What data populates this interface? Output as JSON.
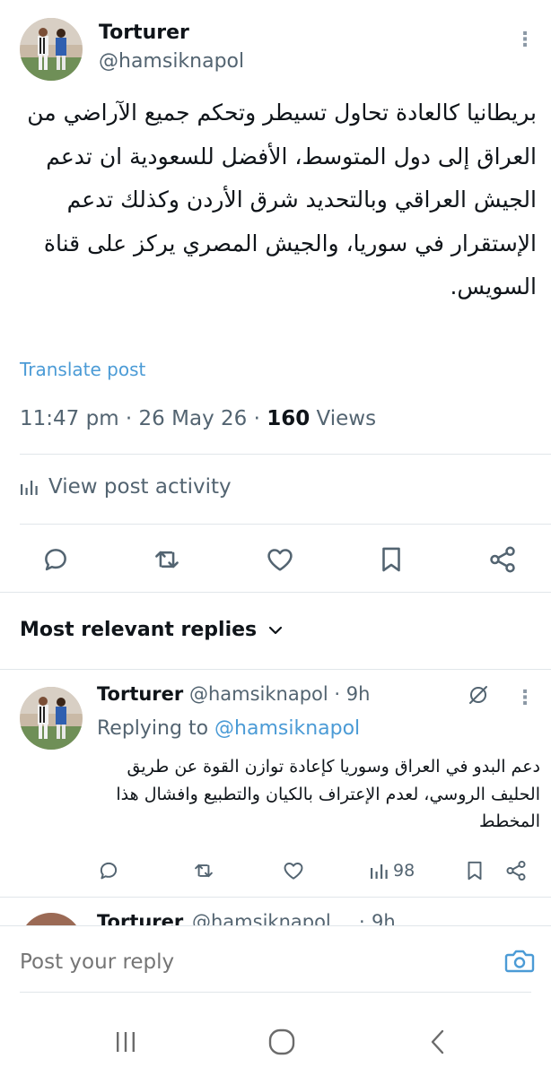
{
  "post": {
    "author_name": "Torturer",
    "author_handle": "@hamsiknapol",
    "text": "بريطانيا كالعادة تحاول تسيطر وتحكم جميع الآراضي من العراق إلى دول المتوسط، الأفضل للسعودية ان تدعم الجيش العراقي وبالتحديد شرق الأردن وكذلك تدعم الإستقرار في سوريا، والجيش المصري يركز على قناة السويس.",
    "translate_label": "Translate post",
    "time": "11:47 pm",
    "date": "26 May 26",
    "views_count": "160",
    "views_label": "Views",
    "meta_separator": "·",
    "view_activity_label": "View post activity",
    "actions": {
      "reply_icon": "reply-icon",
      "repost_icon": "repost-icon",
      "like_icon": "heart-icon",
      "bookmark_icon": "bookmark-icon",
      "share_icon": "share-icon"
    }
  },
  "replies_sort": {
    "label": "Most relevant replies",
    "icon": "chevron-down-icon"
  },
  "reply": {
    "author_name": "Torturer",
    "author_handle": "@hamsiknapol",
    "separator": "·",
    "age": "9h",
    "replying_to_prefix": "Replying to",
    "replying_to_handle": "@hamsiknapol",
    "text": "دعم البدو في العراق وسوريا كإعادة توازن القوة عن طريق الحليف الروسي، لعدم الإعتراف بالكيان والتطبيع وافشال هذا المخطط",
    "views_count": "98"
  },
  "next_reply_peek": {
    "author_name": "Torturer",
    "author_handle": "@hamsiknapol",
    "age": "9h",
    "separator": "·"
  },
  "compose": {
    "placeholder": "Post your reply"
  },
  "colors": {
    "text": "#0f1419",
    "secondary": "#536471",
    "link": "#4b9bd6",
    "divider": "#e1e6ea"
  }
}
